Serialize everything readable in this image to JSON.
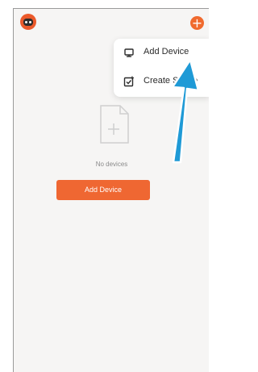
{
  "menu": {
    "items": [
      {
        "label": "Add Device",
        "icon": "add-device-icon"
      },
      {
        "label": "Create Scene",
        "icon": "create-scene-icon"
      }
    ]
  },
  "main": {
    "empty_text": "No devices",
    "add_button": "Add Device"
  },
  "colors": {
    "accent": "#ef6732",
    "annotation_arrow": "#1f9ad6"
  }
}
